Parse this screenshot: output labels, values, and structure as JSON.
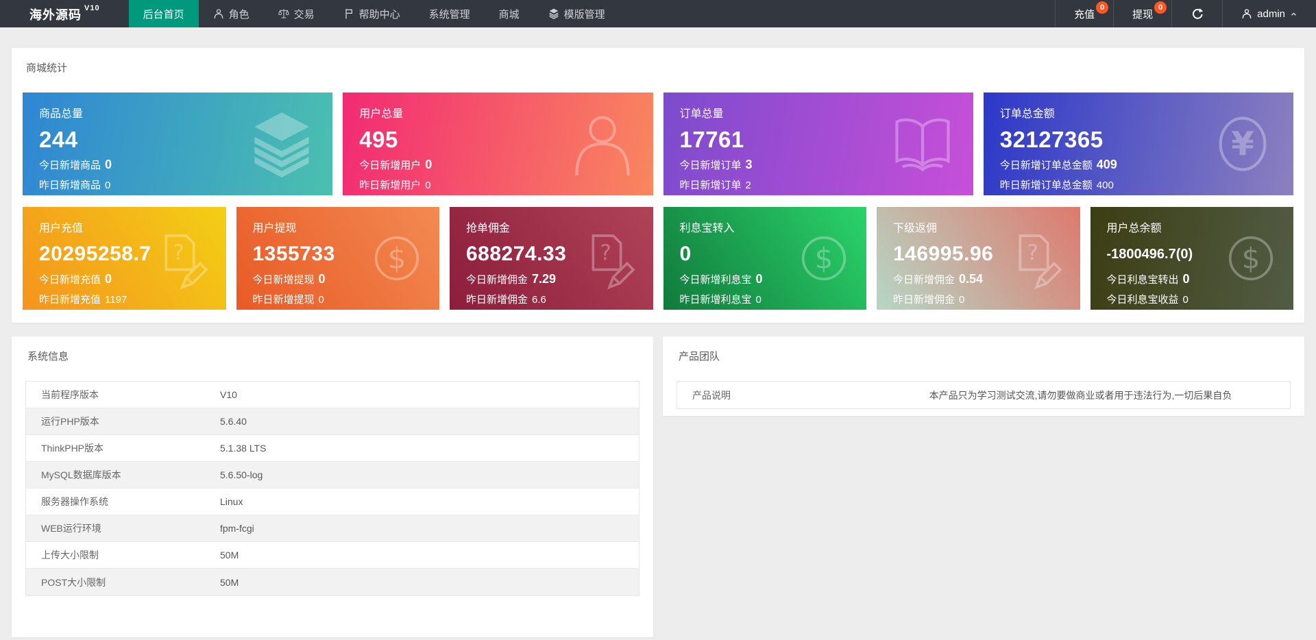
{
  "navbar": {
    "logo": {
      "text": "海外源码",
      "version": "V10"
    },
    "items": [
      {
        "label": "后台首页"
      },
      {
        "label": "角色"
      },
      {
        "label": "交易"
      },
      {
        "label": "帮助中心"
      },
      {
        "label": "系统管理"
      },
      {
        "label": "商城"
      },
      {
        "label": "模版管理"
      }
    ],
    "recharge": {
      "label": "充值",
      "badge": "0"
    },
    "withdraw": {
      "label": "提现",
      "badge": "0"
    },
    "user": {
      "name": "admin"
    }
  },
  "stats": {
    "title": "商城统计",
    "row1": [
      {
        "title": "商品总量",
        "value": "244",
        "today_label": "今日新增商品",
        "today_value": "0",
        "yesterday_label": "昨日新增商品",
        "yesterday_value": "0",
        "gradient": {
          "angle": "100deg",
          "from": "#2f86d4",
          "to": "#4bc0af"
        }
      },
      {
        "title": "用户总量",
        "value": "495",
        "today_label": "今日新增用户",
        "today_value": "0",
        "yesterday_label": "昨日新增用户",
        "yesterday_value": "0",
        "gradient": {
          "angle": "100deg",
          "from": "#f22a74",
          "to": "#f9875f"
        }
      },
      {
        "title": "订单总量",
        "value": "17761",
        "today_label": "今日新增订单",
        "today_value": "3",
        "yesterday_label": "昨日新增订单",
        "yesterday_value": "2",
        "gradient": {
          "angle": "100deg",
          "from": "#7d4bcd",
          "to": "#c74fd9"
        }
      },
      {
        "title": "订单总金额",
        "value": "32127365",
        "today_label": "今日新增订单总金额",
        "today_value": "409",
        "yesterday_label": "昨日新增订单总金额",
        "yesterday_value": "400",
        "gradient": {
          "angle": "100deg",
          "from": "#2c38c8",
          "to": "#8c80bf"
        }
      }
    ],
    "row2": [
      {
        "title": "用户充值",
        "value": "20295258.7",
        "today_label": "今日新增充值",
        "today_value": "0",
        "yesterday_label": "昨日新增充值",
        "yesterday_value": "1197",
        "gradient": {
          "angle": "55deg",
          "from": "#f5941d",
          "to": "#f3cf15"
        }
      },
      {
        "title": "用户提现",
        "value": "1355733",
        "today_label": "今日新增提现",
        "today_value": "0",
        "yesterday_label": "昨日新增提现",
        "yesterday_value": "0",
        "gradient": {
          "angle": "55deg",
          "from": "#e95a25",
          "to": "#f28a52"
        }
      },
      {
        "title": "抢单佣金",
        "value": "688274.33",
        "today_label": "今日新增佣金",
        "today_value": "7.29",
        "yesterday_label": "昨日新增佣金",
        "yesterday_value": "6.6",
        "gradient": {
          "angle": "55deg",
          "from": "#8c1d3c",
          "to": "#b04357"
        }
      },
      {
        "title": "利息宝转入",
        "value": "0",
        "today_label": "今日新增利息宝",
        "today_value": "0",
        "yesterday_label": "昨日新增利息宝",
        "yesterday_value": "0",
        "gradient": {
          "angle": "55deg",
          "from": "#117a3c",
          "to": "#2bd36b"
        }
      },
      {
        "title": "下级返佣",
        "value": "146995.96",
        "today_label": "今日新增佣金",
        "today_value": "0.54",
        "yesterday_label": "昨日新增佣金",
        "yesterday_value": "0",
        "gradient": {
          "angle": "55deg",
          "from": "#b7d6c5",
          "to": "#dd7a6e"
        }
      },
      {
        "title": "用户总余额",
        "value": "-1800496.7(0)",
        "today_label": "今日利息宝转出",
        "today_value": "0",
        "yesterday_label": "今日利息宝收益",
        "yesterday_value": "0",
        "gradient": {
          "angle": "100deg",
          "from": "#3c3e13",
          "to": "#525c45"
        }
      }
    ]
  },
  "system": {
    "title": "系统信息",
    "rows": [
      [
        "当前程序版本",
        "V10"
      ],
      [
        "运行PHP版本",
        "5.6.40"
      ],
      [
        "ThinkPHP版本",
        "5.1.38 LTS"
      ],
      [
        "MySQL数据库版本",
        "5.6.50-log"
      ],
      [
        "服务器操作系统",
        "Linux"
      ],
      [
        "WEB运行环境",
        "fpm-fcgi"
      ],
      [
        "上传大小限制",
        "50M"
      ],
      [
        "POST大小限制",
        "50M"
      ]
    ]
  },
  "product": {
    "title": "产品团队",
    "rows": [
      [
        "产品说明",
        "本产品只为学习测试交流,请勿要做商业或者用于违法行为,一切后果自负"
      ]
    ]
  },
  "colors": {
    "nav_bg": "#33373f",
    "nav_active": "#00997d",
    "badge": "#ff5722",
    "page_bg": "#ededee"
  }
}
